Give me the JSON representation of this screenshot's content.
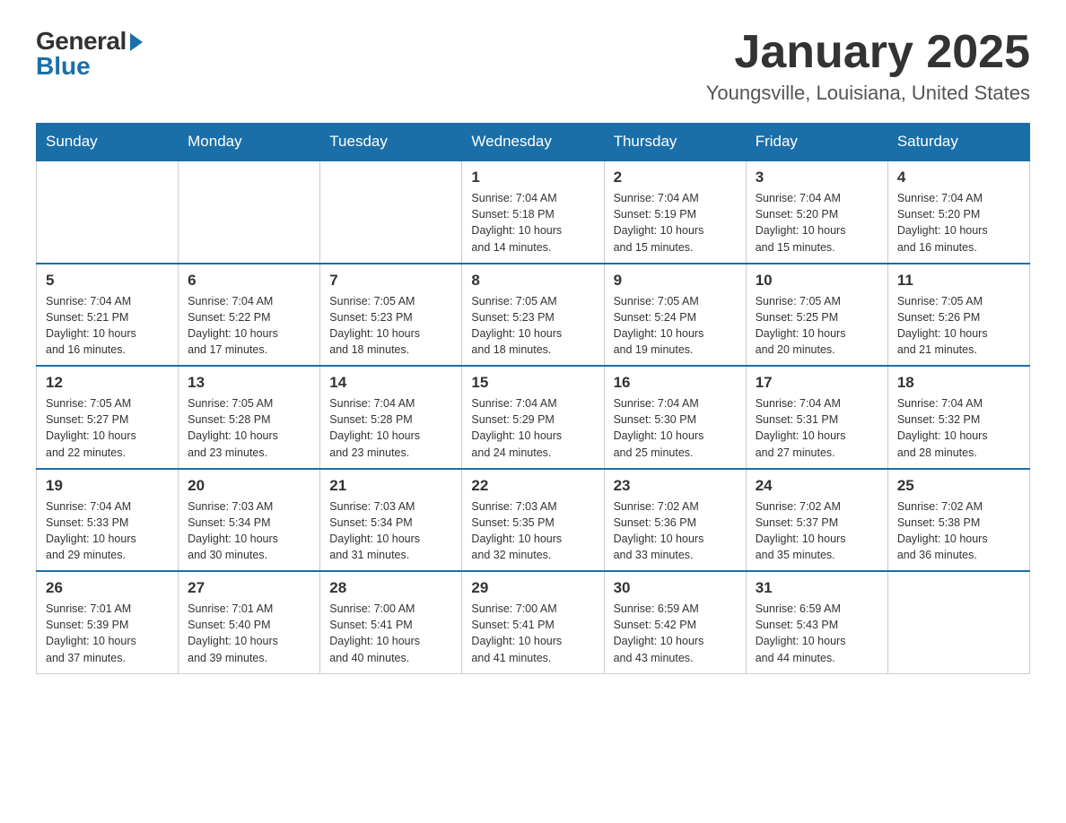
{
  "header": {
    "logo": {
      "general": "General",
      "blue": "Blue"
    },
    "title": "January 2025",
    "subtitle": "Youngsville, Louisiana, United States"
  },
  "weekdays": [
    "Sunday",
    "Monday",
    "Tuesday",
    "Wednesday",
    "Thursday",
    "Friday",
    "Saturday"
  ],
  "weeks": [
    [
      {
        "day": "",
        "info": ""
      },
      {
        "day": "",
        "info": ""
      },
      {
        "day": "",
        "info": ""
      },
      {
        "day": "1",
        "info": "Sunrise: 7:04 AM\nSunset: 5:18 PM\nDaylight: 10 hours\nand 14 minutes."
      },
      {
        "day": "2",
        "info": "Sunrise: 7:04 AM\nSunset: 5:19 PM\nDaylight: 10 hours\nand 15 minutes."
      },
      {
        "day": "3",
        "info": "Sunrise: 7:04 AM\nSunset: 5:20 PM\nDaylight: 10 hours\nand 15 minutes."
      },
      {
        "day": "4",
        "info": "Sunrise: 7:04 AM\nSunset: 5:20 PM\nDaylight: 10 hours\nand 16 minutes."
      }
    ],
    [
      {
        "day": "5",
        "info": "Sunrise: 7:04 AM\nSunset: 5:21 PM\nDaylight: 10 hours\nand 16 minutes."
      },
      {
        "day": "6",
        "info": "Sunrise: 7:04 AM\nSunset: 5:22 PM\nDaylight: 10 hours\nand 17 minutes."
      },
      {
        "day": "7",
        "info": "Sunrise: 7:05 AM\nSunset: 5:23 PM\nDaylight: 10 hours\nand 18 minutes."
      },
      {
        "day": "8",
        "info": "Sunrise: 7:05 AM\nSunset: 5:23 PM\nDaylight: 10 hours\nand 18 minutes."
      },
      {
        "day": "9",
        "info": "Sunrise: 7:05 AM\nSunset: 5:24 PM\nDaylight: 10 hours\nand 19 minutes."
      },
      {
        "day": "10",
        "info": "Sunrise: 7:05 AM\nSunset: 5:25 PM\nDaylight: 10 hours\nand 20 minutes."
      },
      {
        "day": "11",
        "info": "Sunrise: 7:05 AM\nSunset: 5:26 PM\nDaylight: 10 hours\nand 21 minutes."
      }
    ],
    [
      {
        "day": "12",
        "info": "Sunrise: 7:05 AM\nSunset: 5:27 PM\nDaylight: 10 hours\nand 22 minutes."
      },
      {
        "day": "13",
        "info": "Sunrise: 7:05 AM\nSunset: 5:28 PM\nDaylight: 10 hours\nand 23 minutes."
      },
      {
        "day": "14",
        "info": "Sunrise: 7:04 AM\nSunset: 5:28 PM\nDaylight: 10 hours\nand 23 minutes."
      },
      {
        "day": "15",
        "info": "Sunrise: 7:04 AM\nSunset: 5:29 PM\nDaylight: 10 hours\nand 24 minutes."
      },
      {
        "day": "16",
        "info": "Sunrise: 7:04 AM\nSunset: 5:30 PM\nDaylight: 10 hours\nand 25 minutes."
      },
      {
        "day": "17",
        "info": "Sunrise: 7:04 AM\nSunset: 5:31 PM\nDaylight: 10 hours\nand 27 minutes."
      },
      {
        "day": "18",
        "info": "Sunrise: 7:04 AM\nSunset: 5:32 PM\nDaylight: 10 hours\nand 28 minutes."
      }
    ],
    [
      {
        "day": "19",
        "info": "Sunrise: 7:04 AM\nSunset: 5:33 PM\nDaylight: 10 hours\nand 29 minutes."
      },
      {
        "day": "20",
        "info": "Sunrise: 7:03 AM\nSunset: 5:34 PM\nDaylight: 10 hours\nand 30 minutes."
      },
      {
        "day": "21",
        "info": "Sunrise: 7:03 AM\nSunset: 5:34 PM\nDaylight: 10 hours\nand 31 minutes."
      },
      {
        "day": "22",
        "info": "Sunrise: 7:03 AM\nSunset: 5:35 PM\nDaylight: 10 hours\nand 32 minutes."
      },
      {
        "day": "23",
        "info": "Sunrise: 7:02 AM\nSunset: 5:36 PM\nDaylight: 10 hours\nand 33 minutes."
      },
      {
        "day": "24",
        "info": "Sunrise: 7:02 AM\nSunset: 5:37 PM\nDaylight: 10 hours\nand 35 minutes."
      },
      {
        "day": "25",
        "info": "Sunrise: 7:02 AM\nSunset: 5:38 PM\nDaylight: 10 hours\nand 36 minutes."
      }
    ],
    [
      {
        "day": "26",
        "info": "Sunrise: 7:01 AM\nSunset: 5:39 PM\nDaylight: 10 hours\nand 37 minutes."
      },
      {
        "day": "27",
        "info": "Sunrise: 7:01 AM\nSunset: 5:40 PM\nDaylight: 10 hours\nand 39 minutes."
      },
      {
        "day": "28",
        "info": "Sunrise: 7:00 AM\nSunset: 5:41 PM\nDaylight: 10 hours\nand 40 minutes."
      },
      {
        "day": "29",
        "info": "Sunrise: 7:00 AM\nSunset: 5:41 PM\nDaylight: 10 hours\nand 41 minutes."
      },
      {
        "day": "30",
        "info": "Sunrise: 6:59 AM\nSunset: 5:42 PM\nDaylight: 10 hours\nand 43 minutes."
      },
      {
        "day": "31",
        "info": "Sunrise: 6:59 AM\nSunset: 5:43 PM\nDaylight: 10 hours\nand 44 minutes."
      },
      {
        "day": "",
        "info": ""
      }
    ]
  ]
}
